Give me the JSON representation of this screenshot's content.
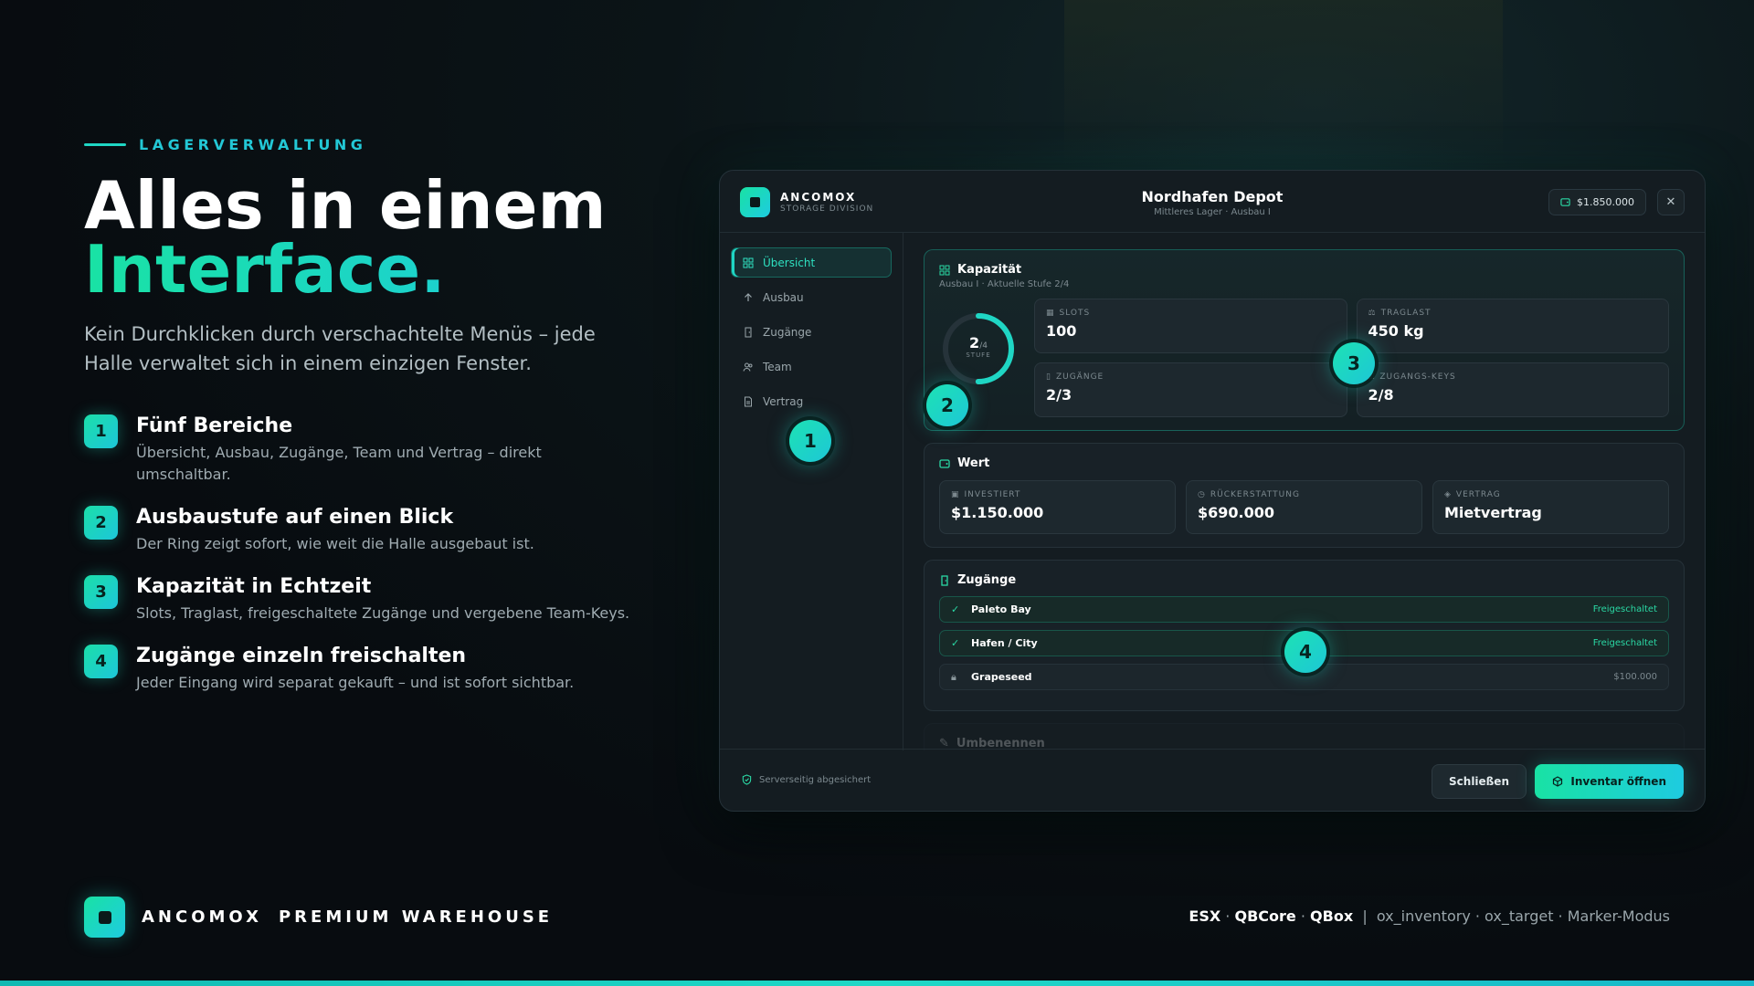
{
  "eyebrow": "LAGERVERWALTUNG",
  "hero": {
    "line1": "Alles in einem",
    "line2": "Interface."
  },
  "lead": "Kein Durchklicken durch verschachtelte Menüs – jede Halle verwaltet sich in einem einzigen Fenster.",
  "features": [
    {
      "num": "1",
      "title": "Fünf Bereiche",
      "text": "Übersicht, Ausbau, Zugänge, Team und Vertrag – direkt umschaltbar."
    },
    {
      "num": "2",
      "title": "Ausbaustufe auf einen Blick",
      "text": "Der Ring zeigt sofort, wie weit die Halle ausgebaut ist."
    },
    {
      "num": "3",
      "title": "Kapazität in Echtzeit",
      "text": "Slots, Traglast, freigeschaltete Zugänge und vergebene Team-Keys."
    },
    {
      "num": "4",
      "title": "Zugänge einzeln freischalten",
      "text": "Jeder Eingang wird separat gekauft – und ist sofort sichtbar."
    }
  ],
  "footer": {
    "brand1": "ANCOMOX",
    "brand2": "PREMIUM WAREHOUSE",
    "frameworks": [
      "ESX",
      "QBCore",
      "QBox"
    ],
    "separator": "|",
    "tech": "ox_inventory · ox_target · Marker-Modus"
  },
  "panel": {
    "brand": "ANCOMOX",
    "brand_sub": "STORAGE DIVISION",
    "title": "Nordhafen Depot",
    "subtitle": "Mittleres Lager · Ausbau I",
    "balance": "$1.850.000",
    "nav": [
      "Übersicht",
      "Ausbau",
      "Zugänge",
      "Team",
      "Vertrag"
    ],
    "capacity": {
      "title": "Kapazität",
      "subtitle": "Ausbau I · Aktuelle Stufe 2/4",
      "ring_value": "2",
      "ring_max": "/4",
      "ring_label": "STUFE",
      "ring_progress": 0.5,
      "stats": [
        {
          "label": "SLOTS",
          "value": "100"
        },
        {
          "label": "TRAGLAST",
          "value": "450 kg"
        },
        {
          "label": "ZUGÄNGE",
          "value": "2/3"
        },
        {
          "label": "ZUGANGS-KEYS",
          "value": "2/8"
        }
      ]
    },
    "value": {
      "title": "Wert",
      "items": [
        {
          "label": "INVESTIERT",
          "value": "$1.150.000"
        },
        {
          "label": "RÜCKERSTATTUNG",
          "value": "$690.000"
        },
        {
          "label": "VERTRAG",
          "value": "Mietvertrag"
        }
      ]
    },
    "access": {
      "title": "Zugänge",
      "rows": [
        {
          "name": "Paleto Bay",
          "status": "Freigeschaltet"
        },
        {
          "name": "Hafen / City",
          "status": "Freigeschaltet"
        },
        {
          "name": "Grapeseed",
          "price": "$100.000"
        }
      ]
    },
    "next_section": "Umbenennen",
    "secure": "Serverseitig abgesichert",
    "btn_close": "Schließen",
    "btn_inventory": "Inventar öffnen"
  },
  "markers": [
    "1",
    "2",
    "3",
    "4"
  ],
  "colors": {
    "accent": "#1fd6c4",
    "accent2": "#19e2a4",
    "panel": "#141c21"
  }
}
